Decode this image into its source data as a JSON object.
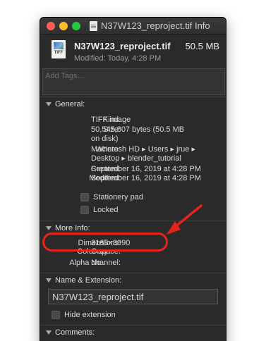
{
  "window": {
    "title": "N37W123_reproject.tif Info"
  },
  "header": {
    "file_name": "N37W123_reproject.tif",
    "file_size": "50.5 MB",
    "modified": "Modified: Today, 4:28 PM",
    "icon_label": "TIFF"
  },
  "tags": {
    "placeholder": "Add Tags…"
  },
  "general": {
    "label": "General:",
    "kind_key": "Kind:",
    "kind_val": "TIFF image",
    "size_key": "Size:",
    "size_val_1": "50,545,807 bytes (50.5 MB",
    "size_val_2": "on disk)",
    "where_key": "Where:",
    "where_val_1": "Macintosh HD ▸ Users ▸ jrue ▸",
    "where_val_2": "Desktop ▸ blender_tutorial",
    "created_key": "Created:",
    "created_val": "September 16, 2019 at 4:28 PM",
    "modified_key": "Modified:",
    "modified_val": "September 16, 2019 at 4:28 PM",
    "stationery": "Stationery pad",
    "locked": "Locked"
  },
  "more_info": {
    "label": "More Info:",
    "dimensions_key": "Dimensions:",
    "dimensions_val": "3165×3990",
    "colorspace_key": "Color space:",
    "colorspace_val": "Gray",
    "alpha_key": "Alpha channel:",
    "alpha_val": "No"
  },
  "name_ext": {
    "label": "Name & Extension:",
    "value": "N37W123_reproject.tif",
    "hide_ext": "Hide extension"
  },
  "comments": {
    "label": "Comments:"
  },
  "colors": {
    "annotation": "#e8231b",
    "window_bg": "#2a2a2a"
  }
}
